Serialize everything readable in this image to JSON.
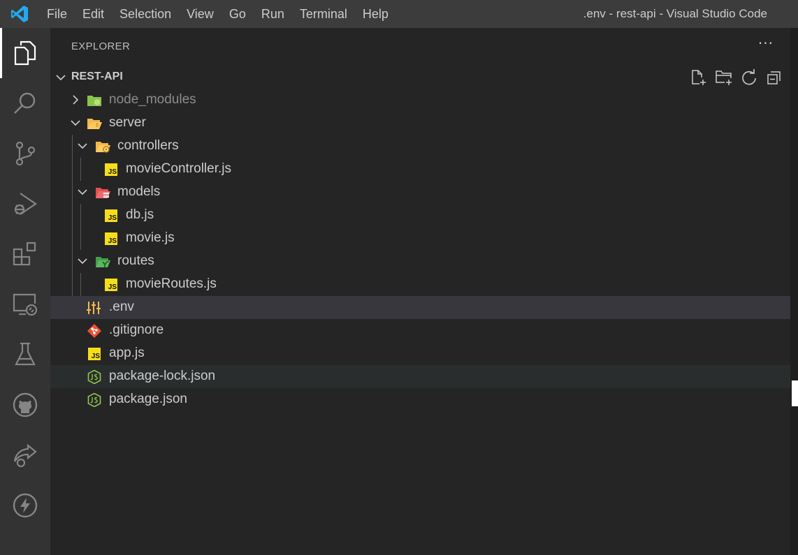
{
  "window": {
    "title": ".env - rest-api - Visual Studio Code"
  },
  "menu": [
    "File",
    "Edit",
    "Selection",
    "View",
    "Go",
    "Run",
    "Terminal",
    "Help"
  ],
  "activity_bar": [
    {
      "name": "explorer-icon",
      "active": true
    },
    {
      "name": "search-icon"
    },
    {
      "name": "source-control-icon"
    },
    {
      "name": "run-debug-icon"
    },
    {
      "name": "extensions-icon"
    },
    {
      "name": "remote-explorer-icon"
    },
    {
      "name": "testing-icon"
    },
    {
      "name": "github-icon"
    },
    {
      "name": "live-share-icon"
    },
    {
      "name": "thunder-client-icon"
    }
  ],
  "sidebar": {
    "title": "EXPLORER",
    "more": "···",
    "root": "REST-API",
    "items": [
      {
        "label": "node_modules",
        "type": "folder",
        "expanded": false,
        "depth": 0,
        "icon": "node-folder-icon"
      },
      {
        "label": "server",
        "type": "folder",
        "expanded": true,
        "depth": 0,
        "icon": "folder-icon"
      },
      {
        "label": "controllers",
        "type": "folder",
        "expanded": true,
        "depth": 1,
        "icon": "controllers-folder-icon"
      },
      {
        "label": "movieController.js",
        "type": "file",
        "depth": 2,
        "icon": "js-file-icon"
      },
      {
        "label": "models",
        "type": "folder",
        "expanded": true,
        "depth": 1,
        "icon": "models-folder-icon"
      },
      {
        "label": "db.js",
        "type": "file",
        "depth": 2,
        "icon": "js-file-icon"
      },
      {
        "label": "movie.js",
        "type": "file",
        "depth": 2,
        "icon": "js-file-icon"
      },
      {
        "label": "routes",
        "type": "folder",
        "expanded": true,
        "depth": 1,
        "icon": "routes-folder-icon"
      },
      {
        "label": "movieRoutes.js",
        "type": "file",
        "depth": 2,
        "icon": "js-file-icon"
      },
      {
        "label": ".env",
        "type": "file",
        "depth": 0,
        "icon": "env-file-icon",
        "selected": true
      },
      {
        "label": ".gitignore",
        "type": "file",
        "depth": 0,
        "icon": "git-file-icon"
      },
      {
        "label": "app.js",
        "type": "file",
        "depth": 0,
        "icon": "js-file-icon"
      },
      {
        "label": "package-lock.json",
        "type": "file",
        "depth": 0,
        "icon": "nodejs-file-icon",
        "hover": true
      },
      {
        "label": "package.json",
        "type": "file",
        "depth": 0,
        "icon": "nodejs-file-icon"
      }
    ]
  },
  "js_badge": "JS",
  "colors": {
    "titlebar": "#3c3c3c",
    "activitybar": "#333333",
    "sidebar": "#252526",
    "selected_row": "#37373d",
    "vscode_blue": "#23a9f2",
    "js_yellow": "#f5de19",
    "git_red": "#f05133",
    "node_green": "#8cc84b"
  }
}
